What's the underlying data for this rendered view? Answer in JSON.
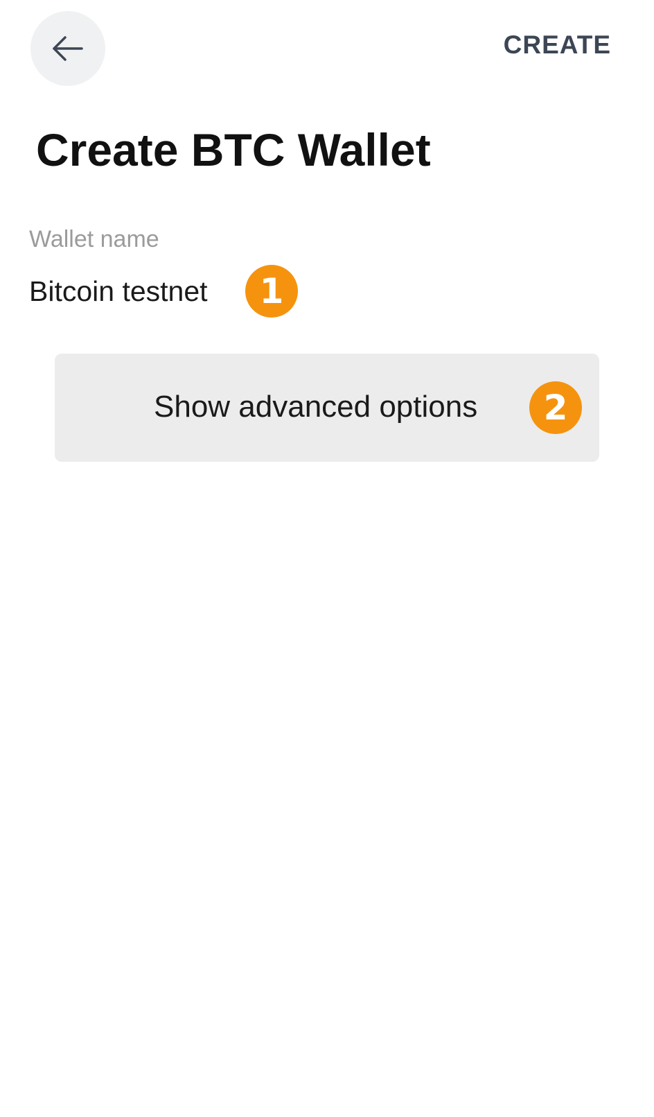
{
  "header": {
    "back_icon": "arrow-left-icon",
    "create_label": "CREATE"
  },
  "page": {
    "title": "Create BTC Wallet"
  },
  "wallet_name": {
    "label": "Wallet name",
    "value": "Bitcoin testnet"
  },
  "advanced": {
    "label": "Show advanced options"
  },
  "markers": {
    "first": "1",
    "second": "2"
  },
  "colors": {
    "marker": "#f5930f",
    "button_bg": "#ececec",
    "action_text": "#3c4654"
  }
}
